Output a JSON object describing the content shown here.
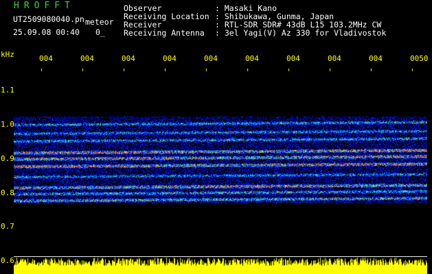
{
  "header": {
    "app_title": "HROFFT",
    "filename": "UT2509080040.pn",
    "tag": "meteor",
    "datetime": "25.09.08 00:40",
    "datetime_suffix": "0_",
    "observer_label": "Observer",
    "observer_value": ": Masaki Kano",
    "location_label": "Receiving Location",
    "location_value": ": Shibukawa, Gunma, Japan",
    "receiver_label": "Receiver",
    "receiver_value": ": RTL-SDR SDR# 43dB L15 103.2MHz CW",
    "antenna_label": "Receiving Antenna",
    "antenna_value": ": 3el Yagi(V) Az 330 for Vladivostok"
  },
  "axis": {
    "y_unit": "kHz",
    "y_ticks": [
      "1.1",
      "1.0",
      "0.9",
      "0.8",
      "0.7",
      "0.6"
    ],
    "x_ticks": [
      "004",
      "004",
      "004",
      "004",
      "004",
      "004",
      "004",
      "004",
      "004",
      "0050"
    ]
  },
  "colors": {
    "background": "#000000",
    "tick_color": "#ffff00",
    "title_color": "#3fd23f",
    "signal_color": "#ffff00"
  }
}
